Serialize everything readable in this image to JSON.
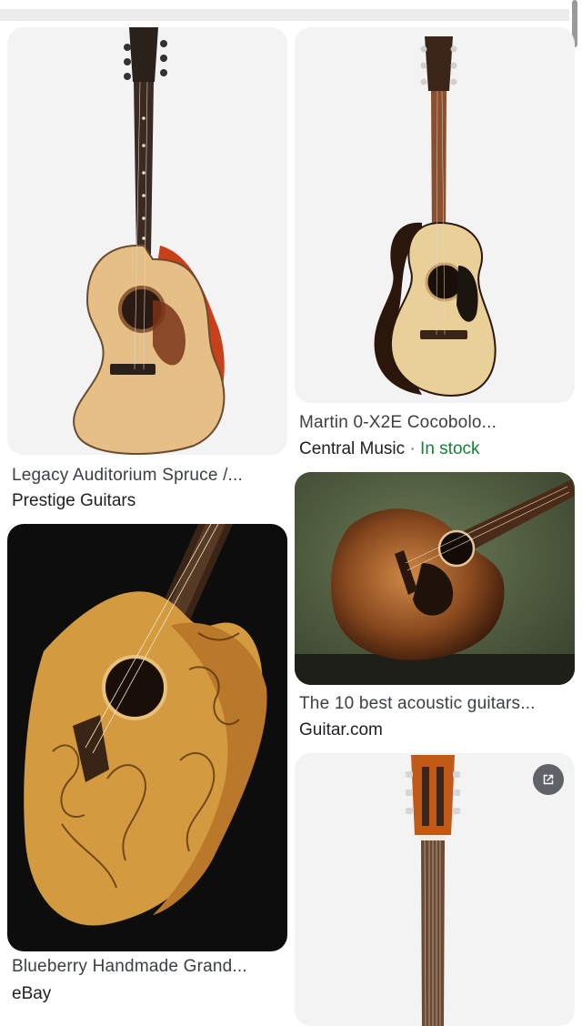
{
  "results": [
    {
      "title": "Legacy Auditorium Spruce /...",
      "source": "Prestige Guitars",
      "stock": ""
    },
    {
      "title": "Martin 0-X2E Cocobolo...",
      "source": "Central Music",
      "separator": "·",
      "stock": "In stock"
    },
    {
      "title": "The 10 best acoustic guitars...",
      "source": "Guitar.com",
      "stock": ""
    },
    {
      "title": "Blueberry Handmade Grand...",
      "source": "eBay",
      "stock": ""
    },
    {
      "title": "",
      "source": "",
      "icon": "open-in-new-icon"
    }
  ],
  "colors": {
    "card_bg": "#f3f3f3",
    "title_text": "#3c4043",
    "source_text": "#202124",
    "stock_green": "#188038"
  }
}
